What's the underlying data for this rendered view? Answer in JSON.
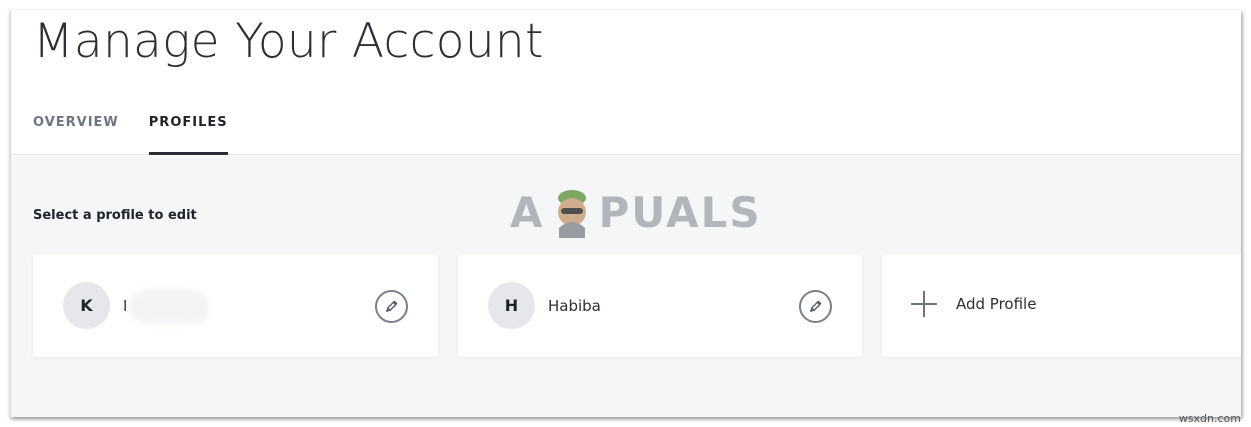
{
  "header": {
    "title": "Manage Your Account",
    "tabs": [
      {
        "label": "OVERVIEW",
        "active": false
      },
      {
        "label": "PROFILES",
        "active": true
      }
    ]
  },
  "main": {
    "section_label": "Select a profile to edit",
    "profiles": [
      {
        "initial": "K",
        "name": "I",
        "name_redacted": true,
        "edit_icon": "pencil-icon"
      },
      {
        "initial": "H",
        "name": "Habiba",
        "edit_icon": "pencil-icon"
      }
    ],
    "add_profile": {
      "label": "Add Profile",
      "icon": "plus-icon"
    }
  },
  "watermark": {
    "text_left": "A",
    "text_right": "PUALS",
    "site": "wsxdn.com"
  },
  "colors": {
    "accent": "#2a2d33",
    "background": "#f5f6f7",
    "card": "#ffffff",
    "muted_text": "#6d7583"
  }
}
